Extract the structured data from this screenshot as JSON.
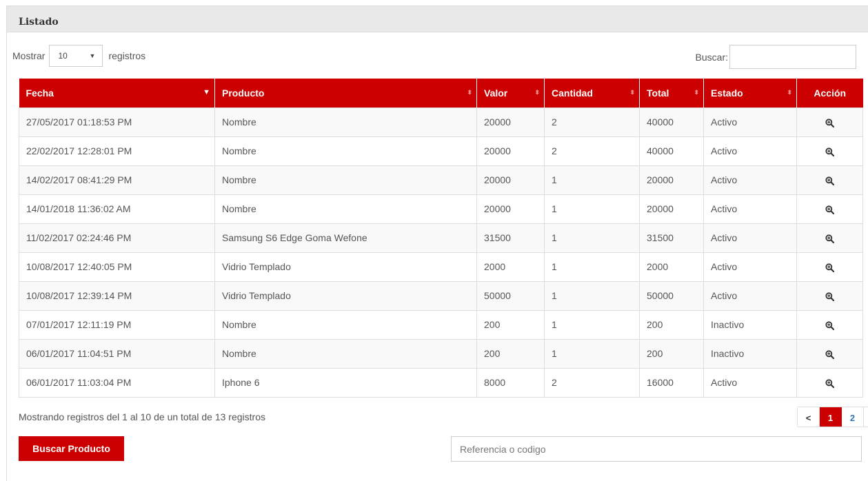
{
  "panel": {
    "title": "Listado"
  },
  "length": {
    "prefix": "Mostrar",
    "value": "10",
    "suffix": "registros"
  },
  "search": {
    "label": "Buscar:"
  },
  "table": {
    "columns": [
      "Fecha",
      "Producto",
      "Valor",
      "Cantidad",
      "Total",
      "Estado",
      "Acción"
    ],
    "rows": [
      [
        "27/05/2017 01:18:53 PM",
        "Nombre",
        "20000",
        "2",
        "40000",
        "Activo"
      ],
      [
        "22/02/2017 12:28:01 PM",
        "Nombre",
        "20000",
        "2",
        "40000",
        "Activo"
      ],
      [
        "14/02/2017 08:41:29 PM",
        "Nombre",
        "20000",
        "1",
        "20000",
        "Activo"
      ],
      [
        "14/01/2018 11:36:02 AM",
        "Nombre",
        "20000",
        "1",
        "20000",
        "Activo"
      ],
      [
        "11/02/2017 02:24:46 PM",
        "Samsung S6 Edge Goma Wefone",
        "31500",
        "1",
        "31500",
        "Activo"
      ],
      [
        "10/08/2017 12:40:05 PM",
        "Vidrio Templado",
        "2000",
        "1",
        "2000",
        "Activo"
      ],
      [
        "10/08/2017 12:39:14 PM",
        "Vidrio Templado",
        "50000",
        "1",
        "50000",
        "Activo"
      ],
      [
        "07/01/2017 12:11:19 PM",
        "Nombre",
        "200",
        "1",
        "200",
        "Inactivo"
      ],
      [
        "06/01/2017 11:04:51 PM",
        "Nombre",
        "200",
        "1",
        "200",
        "Inactivo"
      ],
      [
        "06/01/2017 11:03:04 PM",
        "Iphone 6",
        "8000",
        "2",
        "16000",
        "Activo"
      ]
    ],
    "action_icon": "zoom-in-icon"
  },
  "info": {
    "text": "Mostrando registros del 1 al 10 de un total de 13 registros"
  },
  "pagination": {
    "prev": "<",
    "pages": [
      "1",
      "2"
    ],
    "active": "1",
    "next": ">"
  },
  "footer": {
    "button_label": "Buscar Producto",
    "input_placeholder": "Referencia o codigo"
  },
  "colors": {
    "accent": "#cc0000",
    "link": "#337ab7"
  }
}
